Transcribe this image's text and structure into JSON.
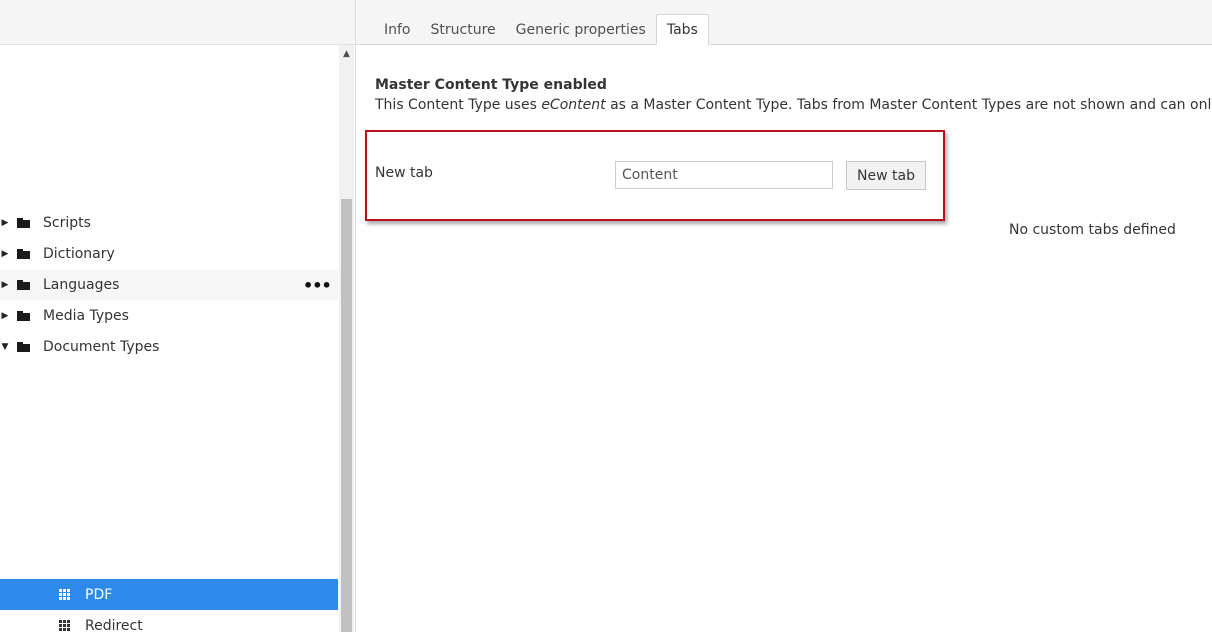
{
  "tabs": [
    {
      "label": "Info"
    },
    {
      "label": "Structure"
    },
    {
      "label": "Generic properties"
    },
    {
      "label": "Tabs"
    }
  ],
  "sidebar": {
    "items": [
      {
        "label": "Scripts",
        "expanded": false
      },
      {
        "label": "Dictionary",
        "expanded": false
      },
      {
        "label": "Languages",
        "expanded": false,
        "menu": "•••"
      },
      {
        "label": "Media Types",
        "expanded": false
      },
      {
        "label": "Document Types",
        "expanded": true
      }
    ],
    "doc_types": [
      {
        "label": "PDF",
        "selected": true
      },
      {
        "label": "Redirect",
        "selected": false
      }
    ]
  },
  "main": {
    "title": "Master Content Type enabled",
    "desc_before": "This Content Type uses ",
    "desc_em": "eContent",
    "desc_after": " as a Master Content Type. Tabs from Master Content Types are not shown and can only be edit",
    "new_tab_label": "New tab",
    "new_tab_input_value": "Content",
    "new_tab_button": "New tab",
    "no_tabs_message": "No custom tabs defined"
  },
  "colors": {
    "selected_bg": "#2e8aea",
    "highlight_border": "#b5121b"
  }
}
